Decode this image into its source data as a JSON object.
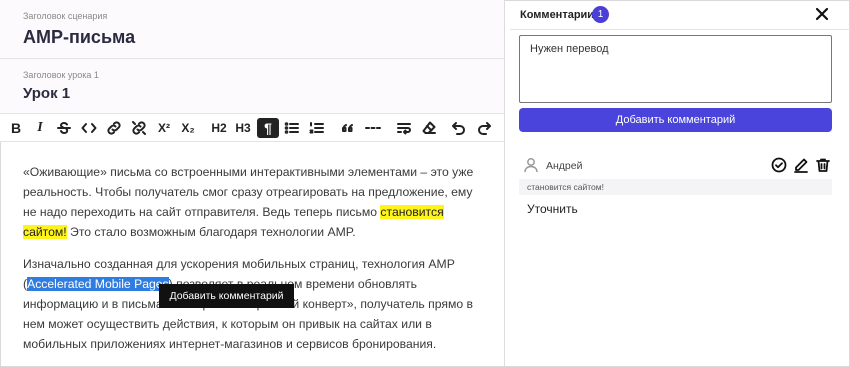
{
  "editor": {
    "scenario_label": "Заголовок сценария",
    "scenario_title": "AMP-письма",
    "lesson_label": "Заголовок урока 1",
    "lesson_title": "Урок 1",
    "toolbar": [
      "bold",
      "italic",
      "strikethrough",
      "code",
      "link",
      "unlink",
      "superscript",
      "subscript",
      "heading-2",
      "heading-3",
      "paragraph",
      "bullet-list",
      "ordered-list",
      "quote",
      "horizontal-rule",
      "wrap",
      "clear-format",
      "undo",
      "redo"
    ],
    "toolbar_labels": {
      "bold": "B",
      "italic": "I",
      "superscript": "X²",
      "subscript": "X₂",
      "h2": "H2",
      "h3": "H3",
      "paragraph": "¶"
    },
    "paragraph1": {
      "before": "«Оживающие» письма со встроенными интерактивными элементами – это уже реальность. Чтобы получатель смог сразу отреагировать на предложение, ему не надо переходить на сайт отправителя. Ведь теперь письмо ",
      "highlight": "становится сайтом!",
      "after": " Это стало возможным благодаря технологии AMP."
    },
    "paragraph2": {
      "before": "Изначально созданная для ускорения мобильных страниц, технология AMP (",
      "selected": "Accelerated Mobile Pages",
      "after": ") позволяет в реальном времени обновлять информацию и в письмах. Теперь «электронный конверт», получатель прямо в нем может осуществить действия, к которым он привык на сайтах или в мобильных приложениях интернет-магазинов и сервисов бронирования."
    },
    "tooltip": "Добавить комментарий",
    "highlight_color": "#fff41a",
    "selection_color": "#2f7de1"
  },
  "comments_panel": {
    "title": "Комментарии",
    "count": "1",
    "textarea_value": "Нужен перевод",
    "add_button": "Добавить комментарий",
    "accent_color": "#4a44dd",
    "items": [
      {
        "author": "Андрей",
        "quote": "становится сайтом!",
        "text": "Уточнить"
      }
    ]
  }
}
